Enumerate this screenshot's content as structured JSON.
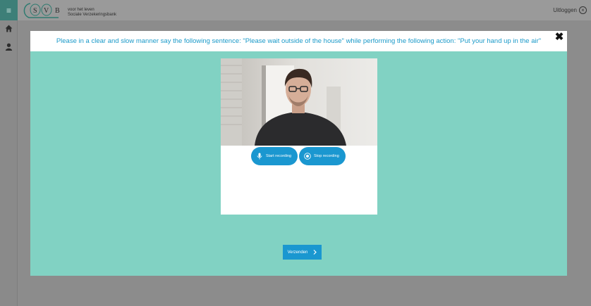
{
  "app": {
    "menu_icon": "hamburger-icon",
    "logo_letters": [
      "S",
      "V",
      "B"
    ],
    "tagline_line1": "voor het leven",
    "tagline_line2": "Sociale Verzekeringsbank",
    "logout_label": "Uitloggen",
    "logout_icon": "close-circle-icon",
    "sidebar_icons": [
      "home-icon",
      "user-icon"
    ]
  },
  "modal": {
    "instruction": "Please in a clear and slow manner say the following sentence: \"Please wait outside of the house\" while performing the following action: \"Put your hand up in the air\"",
    "close_icon": "close-icon",
    "start_recording_label": "Start recording",
    "stop_recording_label": "Stop recording",
    "send_label": "Verzenden",
    "send_icon": "chevron-right-icon"
  },
  "colors": {
    "modal_background": "#81d2c3",
    "accent": "#1a97d0",
    "instruction_text": "#1b9ac9",
    "overlay": "#8c8c8c"
  }
}
